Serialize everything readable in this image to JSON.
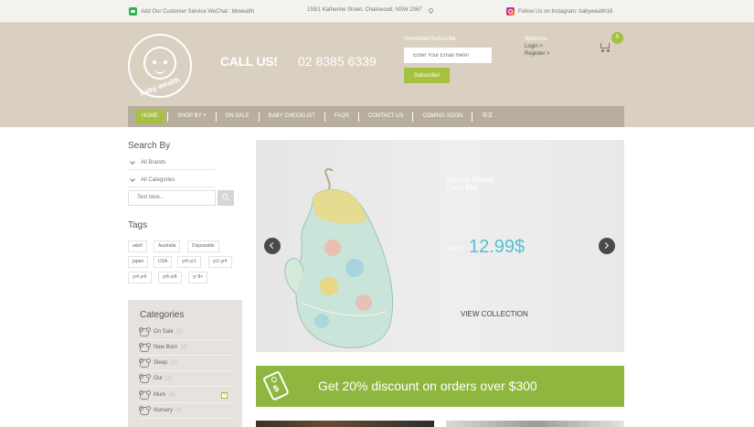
{
  "topbar": {
    "wechat_text": "Add Our Customer Service WeChat : bbwealth",
    "address": "159/1 Katherine Street, Chatswood, NSW 2067",
    "instagram_text": "Follow Us on Instagram: babywealth16"
  },
  "header": {
    "logo_text": "baby wealth",
    "call_us": "CALL US!",
    "phone": "02 8385 6339",
    "newsletter_label": "Newsletter/Subscribe",
    "newsletter_placeholder": "Enter Your Email Here!",
    "subscribe_label": "Subscribe!",
    "welcome": "Welcome",
    "login": "Login >",
    "register": "Register >",
    "cart_count": "0"
  },
  "nav": {
    "items": [
      "HOME",
      "SHOP BY ˅",
      "ON SALE",
      "BABY CHECKLIST",
      "FAQS",
      "CONTACT US",
      "COMING SOON",
      "中文"
    ]
  },
  "sidebar": {
    "search_by": "Search By",
    "all_brands": "All Brands",
    "all_categories": "All Categories",
    "search_placeholder": "Text here...",
    "tags_title": "Tags",
    "tags": [
      "adult",
      "Australia",
      "Disposable",
      "japan",
      "USA",
      "yr0-yr1",
      "yr1-yr4",
      "yr4-yr6",
      "yr6-yr8",
      "yr 8+"
    ],
    "categories_title": "Categories",
    "categories": [
      {
        "label": "On Sale",
        "count": "(1)"
      },
      {
        "label": "New Born",
        "count": "(2)"
      },
      {
        "label": "Sleep",
        "count": "(1)"
      },
      {
        "label": "Out",
        "count": "(1)"
      },
      {
        "label": "Mum",
        "count": "(3)"
      },
      {
        "label": "Nursery",
        "count": "(1)"
      }
    ]
  },
  "slider": {
    "title_line1": "Sewing Basket",
    "title_line2": "Oven Mitt",
    "from": "from:",
    "price": "12.99$",
    "cta": "VIEW COLLECTION"
  },
  "promo": {
    "text": "Get 20% discount on orders over $300"
  },
  "colors": {
    "accent": "#a5c13f",
    "header_bg": "#d9d0c1",
    "nav_bg": "#b8ae9e",
    "price": "#54c0d3"
  }
}
